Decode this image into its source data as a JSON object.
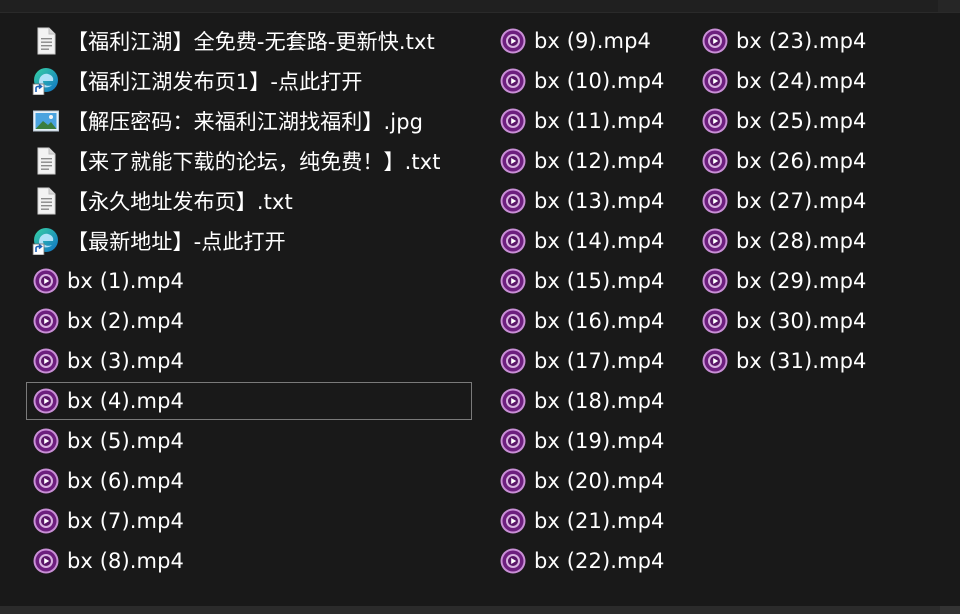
{
  "files": {
    "column1": [
      {
        "name": "【福利江湖】全免费-无套路-更新快.txt",
        "icon": "text-file-icon",
        "type": "txt"
      },
      {
        "name": "【福利江湖发布页1】-点此打开",
        "icon": "edge-shortcut-icon",
        "type": "url"
      },
      {
        "name": "【解压密码：来福利江湖找福利】.jpg",
        "icon": "image-file-icon",
        "type": "jpg"
      },
      {
        "name": "【来了就能下载的论坛，纯免费！】.txt",
        "icon": "text-file-icon",
        "type": "txt"
      },
      {
        "name": "【永久地址发布页】.txt",
        "icon": "text-file-icon",
        "type": "txt"
      },
      {
        "name": "【最新地址】-点此打开",
        "icon": "edge-shortcut-icon",
        "type": "url"
      },
      {
        "name": "bx (1).mp4",
        "icon": "media-player-icon",
        "type": "mp4"
      },
      {
        "name": "bx (2).mp4",
        "icon": "media-player-icon",
        "type": "mp4"
      },
      {
        "name": "bx (3).mp4",
        "icon": "media-player-icon",
        "type": "mp4"
      },
      {
        "name": "bx (4).mp4",
        "icon": "media-player-icon",
        "type": "mp4",
        "focused": true
      },
      {
        "name": "bx (5).mp4",
        "icon": "media-player-icon",
        "type": "mp4"
      },
      {
        "name": "bx (6).mp4",
        "icon": "media-player-icon",
        "type": "mp4"
      },
      {
        "name": "bx (7).mp4",
        "icon": "media-player-icon",
        "type": "mp4"
      },
      {
        "name": "bx (8).mp4",
        "icon": "media-player-icon",
        "type": "mp4"
      }
    ],
    "column2": [
      {
        "name": "bx (9).mp4",
        "icon": "media-player-icon",
        "type": "mp4"
      },
      {
        "name": "bx (10).mp4",
        "icon": "media-player-icon",
        "type": "mp4"
      },
      {
        "name": "bx (11).mp4",
        "icon": "media-player-icon",
        "type": "mp4"
      },
      {
        "name": "bx (12).mp4",
        "icon": "media-player-icon",
        "type": "mp4"
      },
      {
        "name": "bx (13).mp4",
        "icon": "media-player-icon",
        "type": "mp4"
      },
      {
        "name": "bx (14).mp4",
        "icon": "media-player-icon",
        "type": "mp4"
      },
      {
        "name": "bx (15).mp4",
        "icon": "media-player-icon",
        "type": "mp4"
      },
      {
        "name": "bx (16).mp4",
        "icon": "media-player-icon",
        "type": "mp4"
      },
      {
        "name": "bx (17).mp4",
        "icon": "media-player-icon",
        "type": "mp4"
      },
      {
        "name": "bx (18).mp4",
        "icon": "media-player-icon",
        "type": "mp4"
      },
      {
        "name": "bx (19).mp4",
        "icon": "media-player-icon",
        "type": "mp4"
      },
      {
        "name": "bx (20).mp4",
        "icon": "media-player-icon",
        "type": "mp4"
      },
      {
        "name": "bx (21).mp4",
        "icon": "media-player-icon",
        "type": "mp4"
      },
      {
        "name": "bx (22).mp4",
        "icon": "media-player-icon",
        "type": "mp4"
      }
    ],
    "column3": [
      {
        "name": "bx (23).mp4",
        "icon": "media-player-icon",
        "type": "mp4"
      },
      {
        "name": "bx (24).mp4",
        "icon": "media-player-icon",
        "type": "mp4"
      },
      {
        "name": "bx (25).mp4",
        "icon": "media-player-icon",
        "type": "mp4"
      },
      {
        "name": "bx (26).mp4",
        "icon": "media-player-icon",
        "type": "mp4"
      },
      {
        "name": "bx (27).mp4",
        "icon": "media-player-icon",
        "type": "mp4"
      },
      {
        "name": "bx (28).mp4",
        "icon": "media-player-icon",
        "type": "mp4"
      },
      {
        "name": "bx (29).mp4",
        "icon": "media-player-icon",
        "type": "mp4"
      },
      {
        "name": "bx (30).mp4",
        "icon": "media-player-icon",
        "type": "mp4"
      },
      {
        "name": "bx (31).mp4",
        "icon": "media-player-icon",
        "type": "mp4"
      }
    ]
  },
  "colors": {
    "background": "#191919",
    "text": "#ffffff",
    "focus_border": "#7a7a7a",
    "media_icon_purple": "#6d1f7e",
    "media_icon_ring": "#c98fd6"
  }
}
